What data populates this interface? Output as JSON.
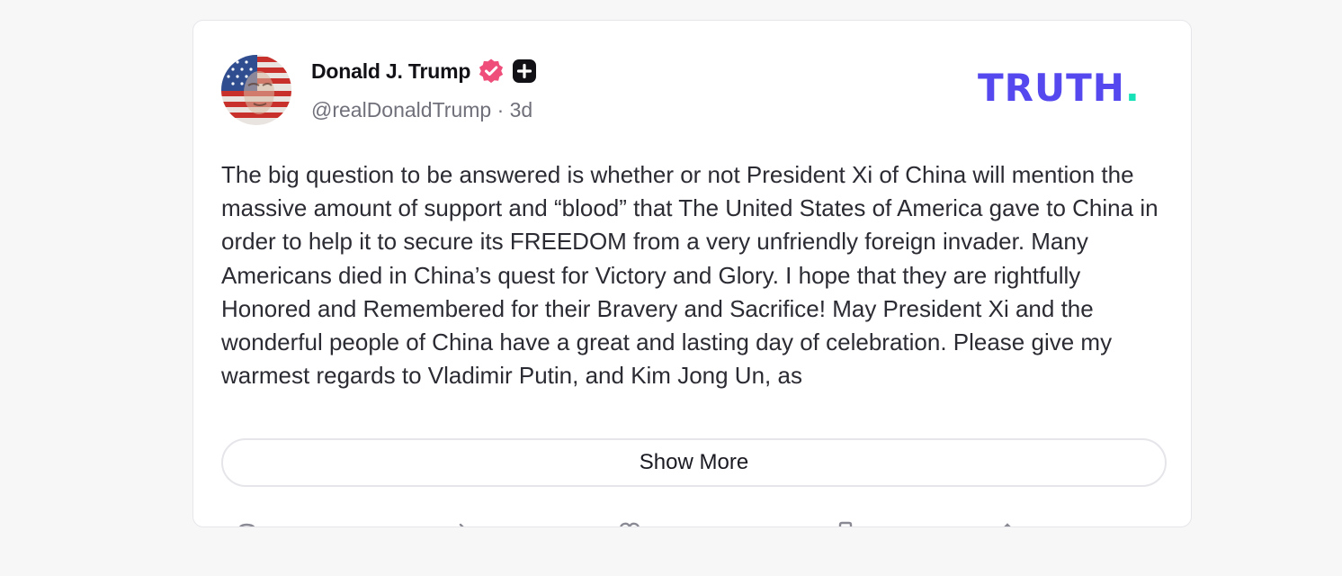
{
  "post": {
    "author": {
      "display_name": "Donald J. Trump",
      "handle": "@realDonaldTrump",
      "separator": "·",
      "time_ago": "3d",
      "avatar_icon": "flag-portrait-avatar",
      "verified_icon": "verified-badge-icon",
      "verified_color": "#ef4e7b",
      "plus_icon": "plus-badge-icon"
    },
    "brand": {
      "logo_text": "TRUTH",
      "logo_dot": ".",
      "logo_color": "#5448ee",
      "dot_color": "#17e1b6"
    },
    "body_text": "The big question to be  answered is whether or not President Xi of China will mention the massive amount of  support and “blood” that The United States of America gave to China in order to help it to secure its FREEDOM from a very unfriendly foreign invader. Many Americans died in China’s quest for Victory and Glory. I hope that they are rightfully Honored and Remembered for their Bravery and Sacrifice! May President Xi and the wonderful people of China have a great and lasting day of celebration. Please give my warmest regards to Vladimir Putin, and Kim Jong Un, as",
    "show_more_label": "Show More",
    "actions": [
      {
        "icon": "reply-icon"
      },
      {
        "icon": "retruth-icon"
      },
      {
        "icon": "like-icon"
      },
      {
        "icon": "bookmark-icon"
      },
      {
        "icon": "share-icon"
      }
    ]
  }
}
